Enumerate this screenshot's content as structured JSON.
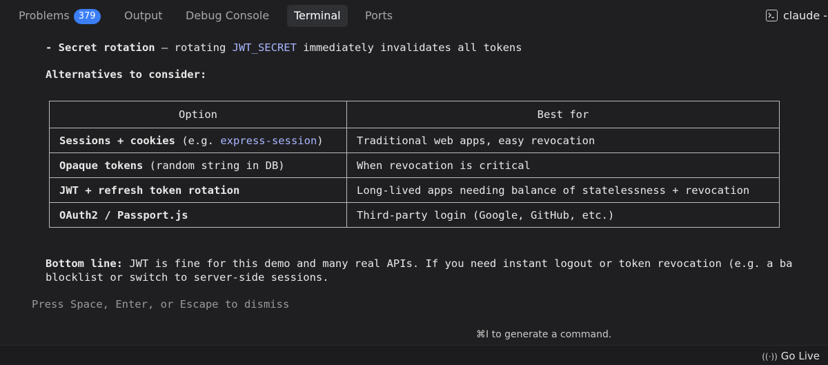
{
  "tabs": [
    {
      "label": "Problems",
      "badge": "379"
    },
    {
      "label": "Output"
    },
    {
      "label": "Debug Console"
    },
    {
      "label": "Terminal",
      "active": true
    },
    {
      "label": "Ports"
    }
  ],
  "terminal_name": "claude -",
  "content": {
    "secret_line": {
      "prefix": "- Secret rotation",
      "middle": " – rotating ",
      "code": "JWT_SECRET",
      "suffix": " immediately invalidates all tokens"
    },
    "alternatives_heading": "Alternatives to consider:",
    "table": {
      "headers": [
        "Option",
        "Best for"
      ],
      "rows": [
        {
          "option_main": "Sessions + cookies",
          "option_rest": " (e.g. ",
          "option_code": "express-session",
          "option_tail": ")",
          "best_for": "Traditional web apps, easy revocation"
        },
        {
          "option_main": "Opaque tokens",
          "option_rest": " (random string in DB)",
          "option_code": "",
          "option_tail": "",
          "best_for": "When revocation is critical"
        },
        {
          "option_main": "JWT + refresh token rotation",
          "option_rest": "",
          "option_code": "",
          "option_tail": "",
          "best_for": "Long-lived apps needing balance of statelessness + revocation"
        },
        {
          "option_main": "OAuth2 / Passport.js",
          "option_rest": "",
          "option_code": "",
          "option_tail": "",
          "best_for": "Third-party login (Google, GitHub, etc.)"
        }
      ]
    },
    "bottom_line": {
      "label": "Bottom line:",
      "text1": " JWT is fine for this demo and many real APIs. If you need instant logout or token revocation (e.g. a ba",
      "text2": "blocklist or switch to server-side sessions."
    },
    "dismiss": "Press Space, Enter, or Escape to dismiss"
  },
  "hint": "⌘I to generate a command.",
  "status": {
    "go_live": "Go Live"
  },
  "colors": {
    "background": "#1f1f21",
    "badge": "#3b7ef6",
    "code_accent": "#a9b6ff"
  }
}
